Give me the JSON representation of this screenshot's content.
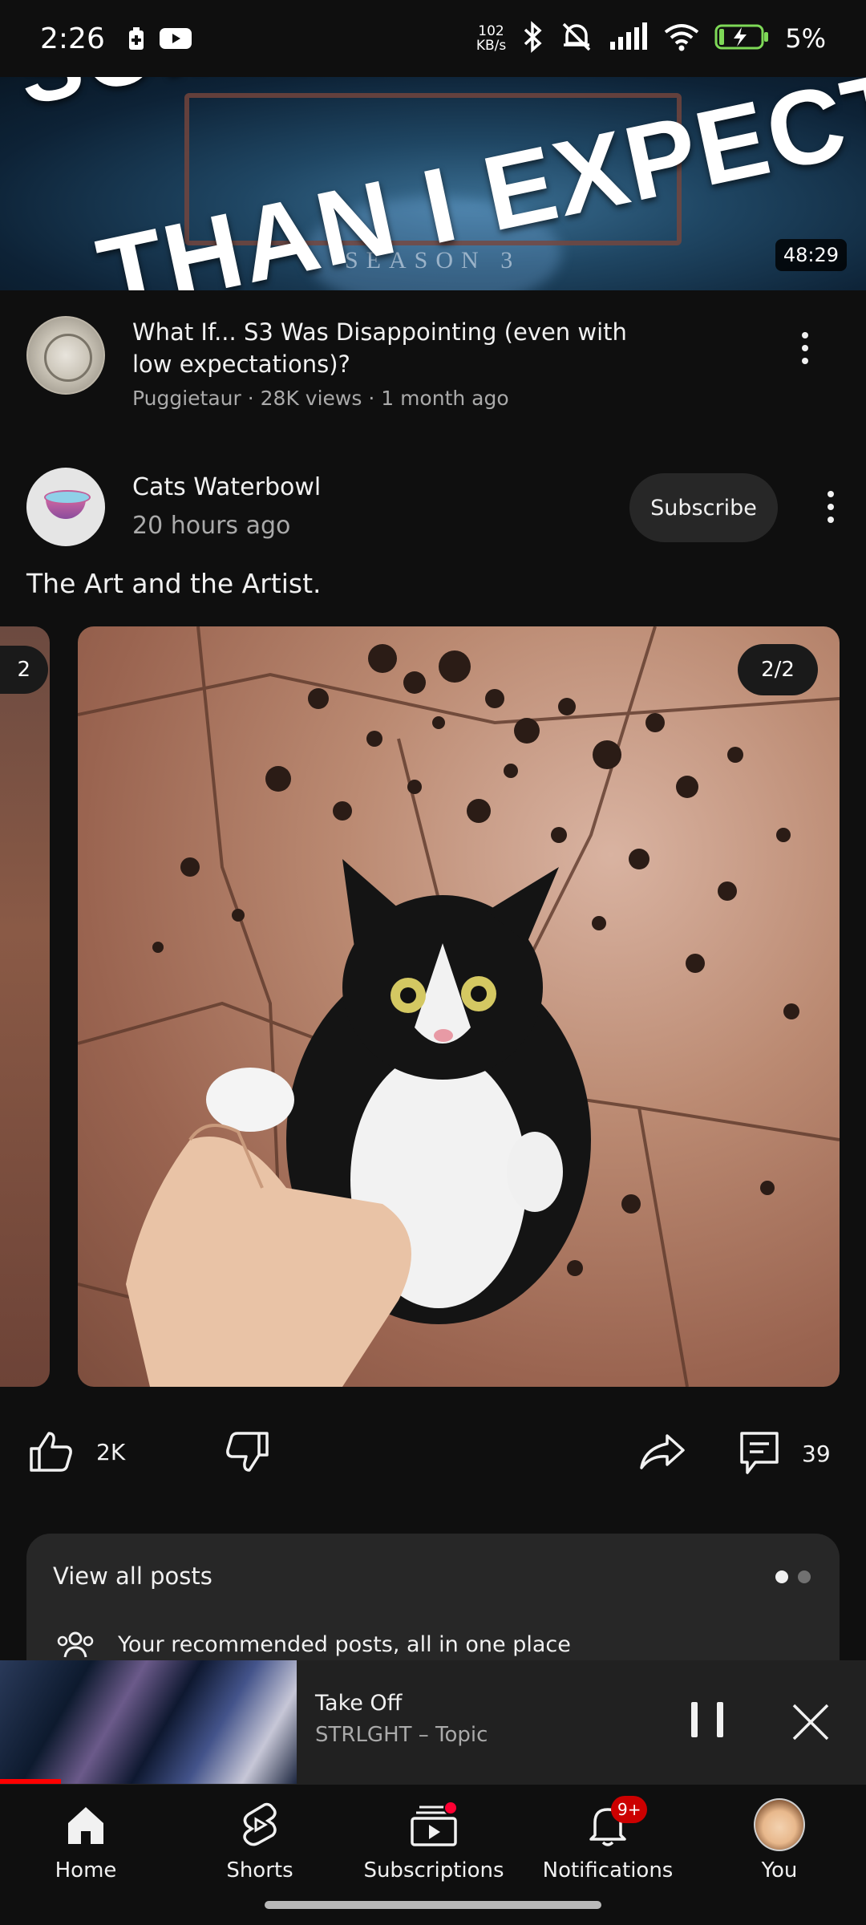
{
  "status_bar": {
    "time": "2:26",
    "speed_value": "102",
    "speed_unit": "KB/s",
    "battery": "5%"
  },
  "video": {
    "thumbnail_text_line1": "SOME",
    "thumbnail_text_line2": "THAN I EXPECTE",
    "thumbnail_season": "SEASON 3",
    "duration": "48:29",
    "title": "What If... S3 Was Disappointing (even with low expectations)?",
    "meta": "Puggietaur · 28K views · 1 month ago"
  },
  "post": {
    "channel_name": "Cats Waterbowl",
    "time_ago": "20 hours ago",
    "subscribe_label": "Subscribe",
    "text": "The Art and the Artist.",
    "prev_badge": "2",
    "image_badge": "2/2",
    "likes": "2K",
    "comments": "39"
  },
  "posts_card": {
    "title": "View all posts",
    "subtitle": "Your recommended posts, all in one place",
    "page_count": 2,
    "active_page": 1
  },
  "mini_player": {
    "title": "Take Off",
    "artist": "STRLGHT – Topic",
    "progress": 0.07
  },
  "nav": {
    "items": [
      {
        "label": "Home",
        "icon": "home-icon"
      },
      {
        "label": "Shorts",
        "icon": "shorts-icon"
      },
      {
        "label": "Subscriptions",
        "icon": "subscriptions-icon"
      },
      {
        "label": "Notifications",
        "icon": "bell-icon"
      },
      {
        "label": "You",
        "icon": "avatar"
      }
    ],
    "notification_badge": "9+"
  },
  "colors": {
    "background": "#0f0f0f",
    "surface": "#272727",
    "accent_red": "#ff0000",
    "text_primary": "#f1f1f1",
    "text_secondary": "#aaaaaa"
  }
}
